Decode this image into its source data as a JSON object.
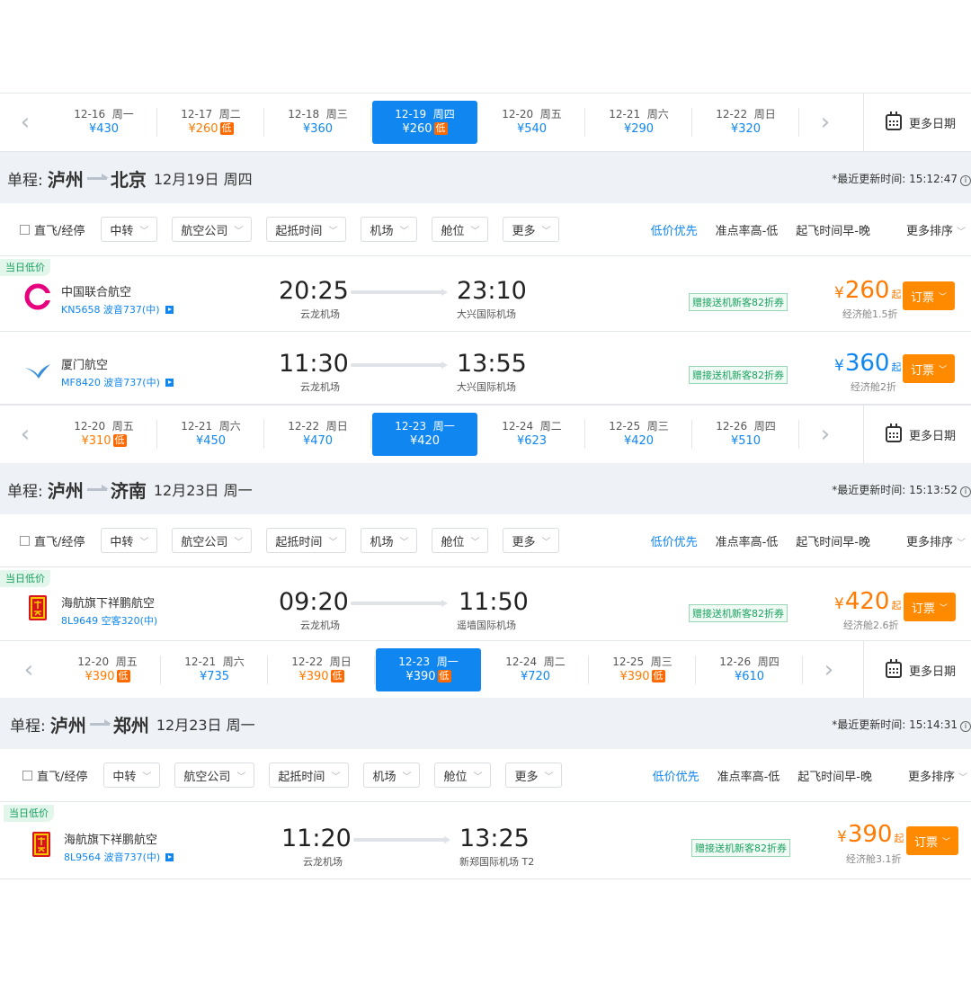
{
  "blocks": [
    {
      "dates": [
        {
          "date": "12-16",
          "weekday": "周一",
          "price": "¥430",
          "low": ""
        },
        {
          "date": "12-17",
          "weekday": "周二",
          "price": "¥260",
          "low": "低"
        },
        {
          "date": "12-18",
          "weekday": "周三",
          "price": "¥360",
          "low": ""
        },
        {
          "date": "12-19",
          "weekday": "周四",
          "price": "¥260",
          "low": "低"
        },
        {
          "date": "12-20",
          "weekday": "周五",
          "price": "¥540",
          "low": ""
        },
        {
          "date": "12-21",
          "weekday": "周六",
          "price": "¥290",
          "low": ""
        },
        {
          "date": "12-22",
          "weekday": "周日",
          "price": "¥320",
          "low": ""
        }
      ],
      "route": {
        "label": "单程:",
        "from": "泸州",
        "to": "北京",
        "date": "12月19日 周四",
        "updated": "*最近更新时间: 15:12:47"
      },
      "flights": [
        {
          "badge": "当日低价",
          "airline": "中国联合航空",
          "flight_no": "KN5658 波音737(中)",
          "dep_time": "20:25",
          "dep_airport": "云龙机场",
          "arr_time": "23:10",
          "arr_airport": "大兴国际机场",
          "promo": "赠接送机新客82折券",
          "price": "260",
          "cabin": "经济舱1.5折",
          "logo": "china-united-logo"
        },
        {
          "badge": "",
          "airline": "厦门航空",
          "flight_no": "MF8420 波音737(中)",
          "dep_time": "11:30",
          "dep_airport": "云龙机场",
          "arr_time": "13:55",
          "arr_airport": "大兴国际机场",
          "promo": "赠接送机新客82折券",
          "price": "360",
          "cabin": "经济舱2折",
          "logo": "xiamen-airlines-logo"
        }
      ]
    },
    {
      "dates": [
        {
          "date": "12-20",
          "weekday": "周五",
          "price": "¥310",
          "low": "低"
        },
        {
          "date": "12-21",
          "weekday": "周六",
          "price": "¥450",
          "low": ""
        },
        {
          "date": "12-22",
          "weekday": "周日",
          "price": "¥470",
          "low": ""
        },
        {
          "date": "12-23",
          "weekday": "周一",
          "price": "¥420",
          "low": ""
        },
        {
          "date": "12-24",
          "weekday": "周二",
          "price": "¥623",
          "low": ""
        },
        {
          "date": "12-25",
          "weekday": "周三",
          "price": "¥420",
          "low": ""
        },
        {
          "date": "12-26",
          "weekday": "周四",
          "price": "¥510",
          "low": ""
        }
      ],
      "route": {
        "label": "单程:",
        "from": "泸州",
        "to": "济南",
        "date": "12月23日 周一",
        "updated": "*最近更新时间: 15:13:52"
      },
      "flights": [
        {
          "badge": "当日低价",
          "airline": "海航旗下祥鹏航空",
          "flight_no": "8L9649 空客320(中)",
          "dep_time": "09:20",
          "dep_airport": "云龙机场",
          "arr_time": "11:50",
          "arr_airport": "遥墙国际机场",
          "promo": "赠接送机新客82折券",
          "price": "420",
          "cabin": "经济舱2.6折",
          "logo": "lucky-air-logo"
        }
      ]
    },
    {
      "dates": [
        {
          "date": "12-20",
          "weekday": "周五",
          "price": "¥390",
          "low": "低"
        },
        {
          "date": "12-21",
          "weekday": "周六",
          "price": "¥735",
          "low": ""
        },
        {
          "date": "12-22",
          "weekday": "周日",
          "price": "¥390",
          "low": "低"
        },
        {
          "date": "12-23",
          "weekday": "周一",
          "price": "¥390",
          "low": "低"
        },
        {
          "date": "12-24",
          "weekday": "周二",
          "price": "¥720",
          "low": ""
        },
        {
          "date": "12-25",
          "weekday": "周三",
          "price": "¥390",
          "low": "低"
        },
        {
          "date": "12-26",
          "weekday": "周四",
          "price": "¥610",
          "low": ""
        }
      ],
      "route": {
        "label": "单程:",
        "from": "泸州",
        "to": "郑州",
        "date": "12月23日 周一",
        "updated": "*最近更新时间: 15:14:31"
      },
      "flights": [
        {
          "badge": "当日低价",
          "airline": "海航旗下祥鹏航空",
          "flight_no": "8L9564 波音737(中)",
          "dep_time": "11:20",
          "dep_airport": "云龙机场",
          "arr_time": "13:25",
          "arr_airport": "新郑国际机场 T2",
          "promo": "赠接送机新客82折券",
          "price": "390",
          "cabin": "经济舱3.1折",
          "logo": "lucky-air-logo"
        }
      ]
    }
  ],
  "common": {
    "more_dates": "更多日期",
    "prev_icon": "chevron-left-icon",
    "next_icon": "chevron-right-icon",
    "calendar_icon": "calendar-icon",
    "filters": {
      "direct": "直飞/经停",
      "transfer": "中转",
      "airline": "航空公司",
      "time": "起抵时间",
      "airport": "机场",
      "cabin": "舱位",
      "more": "更多"
    },
    "sorts": {
      "low_price": "低价优先",
      "punctual": "准点率高-低",
      "early": "起飞时间早-晚",
      "more_sort": "更多排序"
    },
    "yen": "¥",
    "qi": "起",
    "book": "订票",
    "colors": {
      "accent": "#0f86f0",
      "orange": "#ff7a00",
      "green": "#1aa15f"
    }
  }
}
